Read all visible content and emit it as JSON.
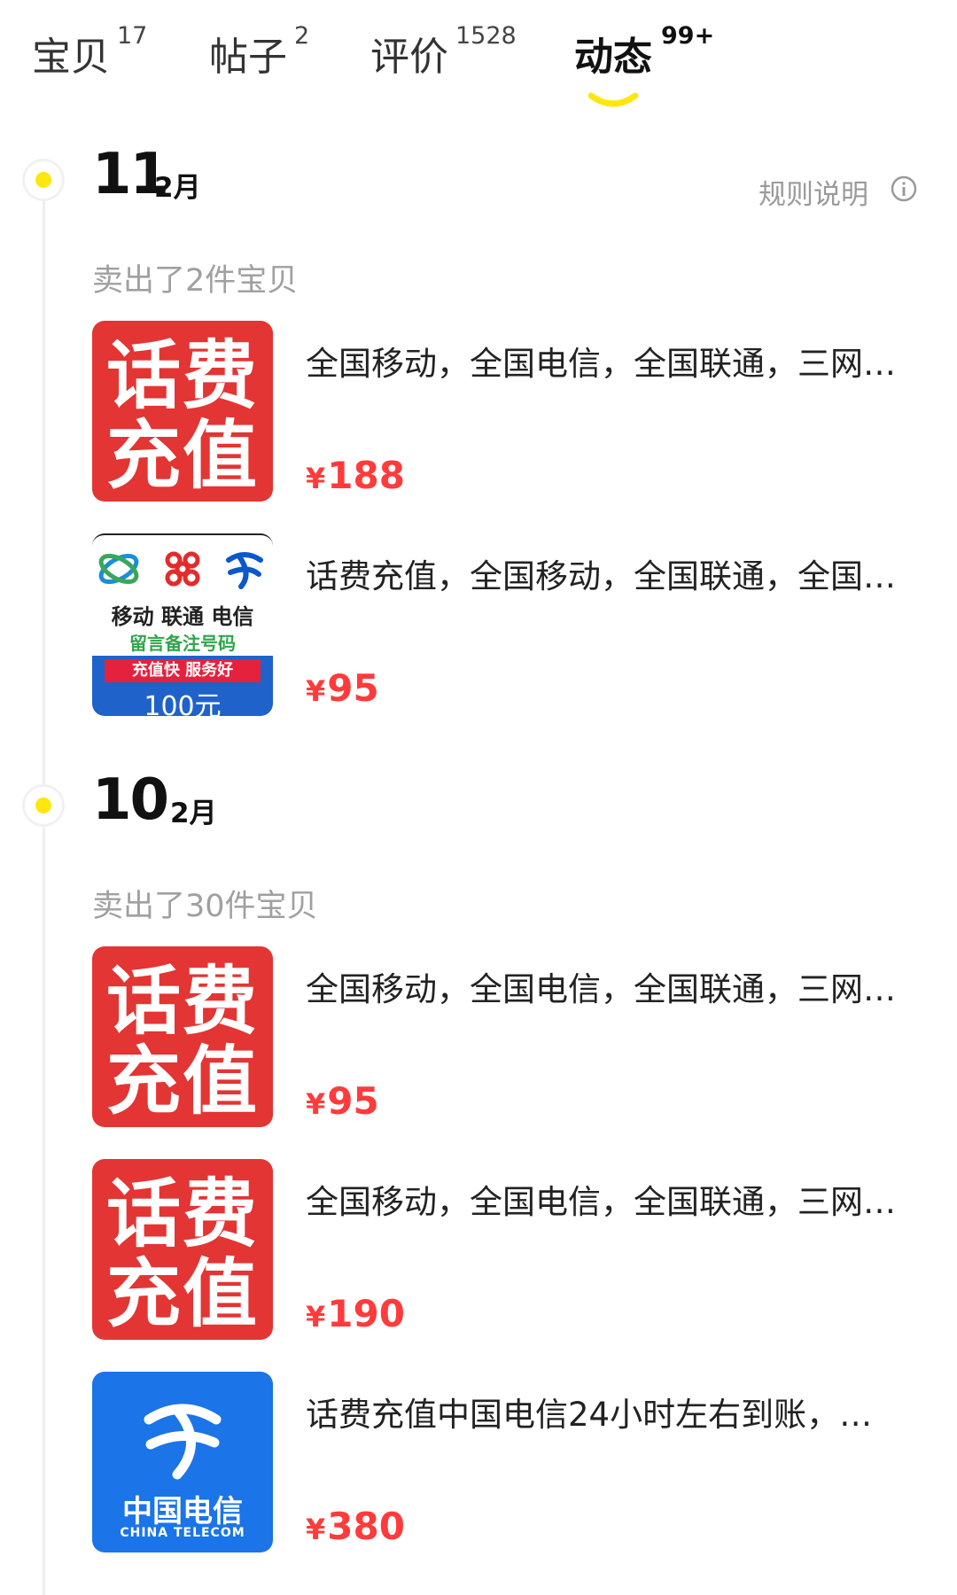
{
  "tabs": [
    {
      "label": "宝贝",
      "count": "17"
    },
    {
      "label": "帖子",
      "count": "2"
    },
    {
      "label": "评价",
      "count": "1528"
    },
    {
      "label": "动态",
      "count": "99+"
    }
  ],
  "active_tab": "动态",
  "accent_color": "#ffe60f",
  "price_color": "#ff3b3b",
  "rules_link": "规则说明",
  "groups": [
    {
      "day": "11",
      "month": "2月",
      "sold_text": "卖出了2件宝贝",
      "items": [
        {
          "thumb": "话费充值",
          "thumb_lines": [
            "话费",
            "充值"
          ],
          "title": "全国移动，全国电信，全国联通，三网…",
          "price": "188"
        },
        {
          "thumb": "carrier-banner",
          "thumb_names": "移动 联通 电信",
          "thumb_note": "留言备注号码",
          "thumb_banner": "充值快 服务好",
          "thumb_amount": "100元",
          "title": "话费充值，全国移动，全国联通，全国…",
          "price": "95"
        }
      ]
    },
    {
      "day": "10",
      "month": "2月",
      "sold_text": "卖出了30件宝贝",
      "items": [
        {
          "thumb": "话费充值",
          "thumb_lines": [
            "话费",
            "充值"
          ],
          "title": "全国移动，全国电信，全国联通，三网…",
          "price": "95"
        },
        {
          "thumb": "话费充值",
          "thumb_lines": [
            "话费",
            "充值"
          ],
          "title": "全国移动，全国电信，全国联通，三网…",
          "price": "190"
        },
        {
          "thumb": "china-telecom",
          "thumb_cn": "中国电信",
          "thumb_en": "CHINA TELECOM",
          "title": "话费充值中国电信24小时左右到账，…",
          "price": "380"
        }
      ]
    }
  ],
  "currency": "¥"
}
